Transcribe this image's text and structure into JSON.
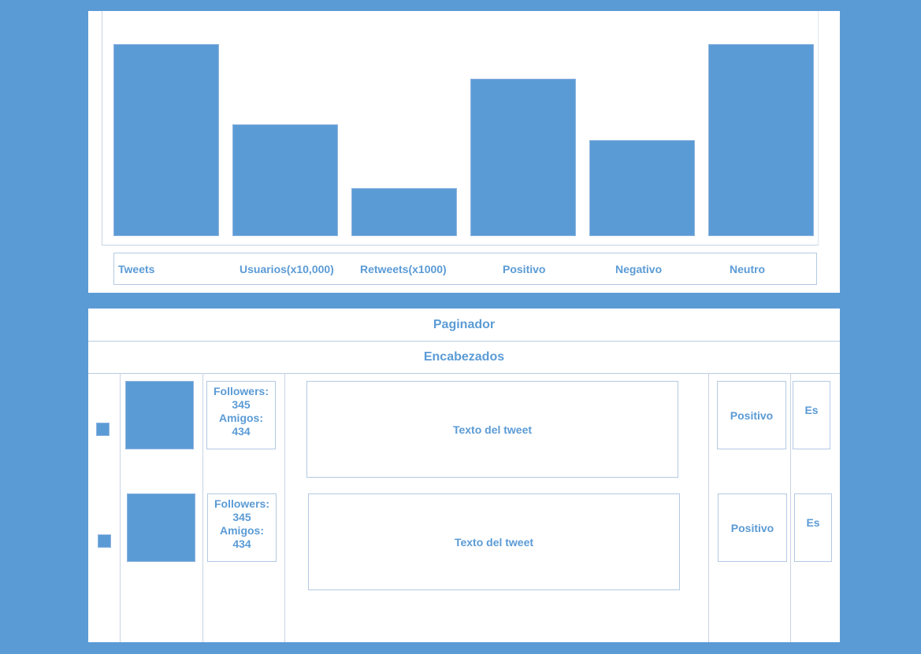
{
  "colors": {
    "accent": "#5b9bd5",
    "background": "#5b9bd5",
    "panel": "#ffffff"
  },
  "chart_data": {
    "type": "bar",
    "categories": [
      "Tweets",
      "Usuarios(x10,000)",
      "Retweets(x1000)",
      "Positivo",
      "Negativo",
      "Neutro"
    ],
    "values": [
      100,
      58,
      25,
      82,
      50,
      100
    ],
    "ylim": [
      0,
      100
    ],
    "title": "",
    "xlabel": "",
    "ylabel": ""
  },
  "table": {
    "paginator_label": "Paginador",
    "headers_label": "Encabezados",
    "rows": [
      {
        "stats_line1": "Followers:",
        "stats_line2": "345",
        "stats_line3": "Amigos:",
        "stats_line4": "434",
        "tweet_text": "Texto del tweet",
        "sentiment": "Positivo",
        "language": "Es"
      },
      {
        "stats_line1": "Followers:",
        "stats_line2": "345",
        "stats_line3": "Amigos:",
        "stats_line4": "434",
        "tweet_text": "Texto del tweet",
        "sentiment": "Positivo",
        "language": "Es"
      }
    ]
  }
}
